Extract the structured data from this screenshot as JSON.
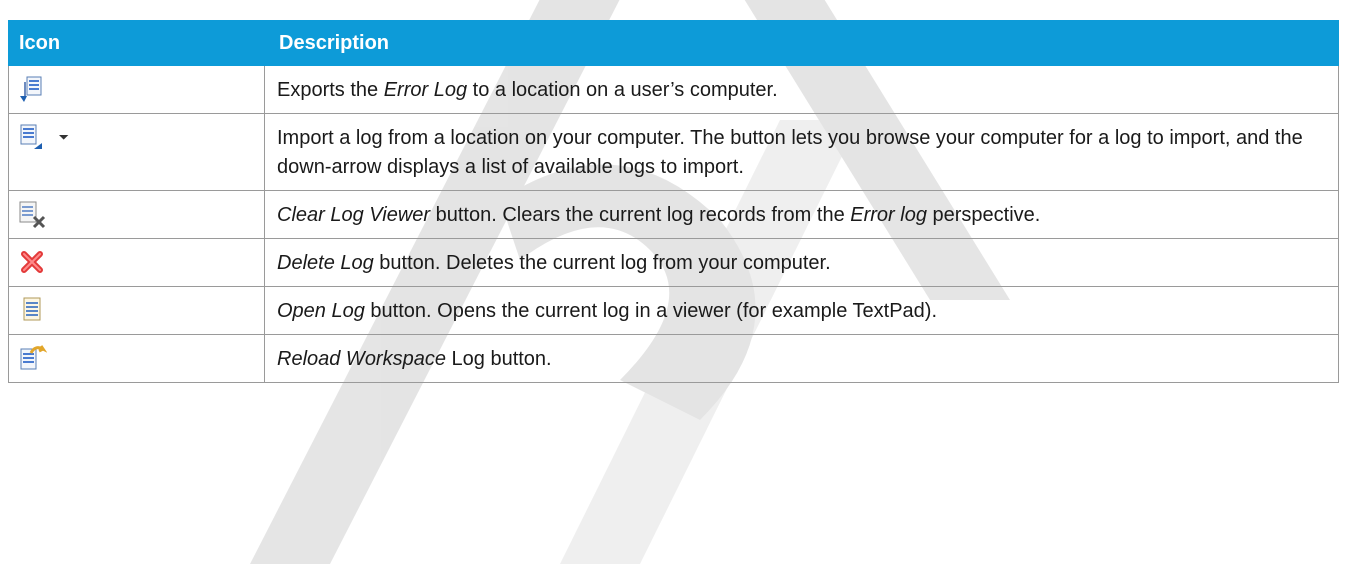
{
  "table": {
    "headers": {
      "icon": "Icon",
      "description": "Description"
    },
    "rows": [
      {
        "icon": "export-log-icon",
        "extra_icon": "",
        "parts": [
          {
            "text": "Exports the ",
            "italic": false
          },
          {
            "text": "Error Log",
            "italic": true
          },
          {
            "text": " to a location on a user’s computer.",
            "italic": false
          }
        ]
      },
      {
        "icon": "import-log-icon",
        "extra_icon": "dropdown-arrow-icon",
        "parts": [
          {
            "text": "Import a log from a location on your computer. The button lets you browse your computer for a log to import, and the down-arrow displays a list of available logs to import.",
            "italic": false
          }
        ]
      },
      {
        "icon": "clear-log-viewer-icon",
        "extra_icon": "",
        "parts": [
          {
            "text": "Clear Log Viewer",
            "italic": true
          },
          {
            "text": " button. Clears the current log records from the ",
            "italic": false
          },
          {
            "text": "Error log",
            "italic": true
          },
          {
            "text": " perspective.",
            "italic": false
          }
        ]
      },
      {
        "icon": "delete-log-icon",
        "extra_icon": "",
        "parts": [
          {
            "text": "Delete Log",
            "italic": true
          },
          {
            "text": " button. Deletes the current log from your computer.",
            "italic": false
          }
        ]
      },
      {
        "icon": "open-log-icon",
        "extra_icon": "",
        "parts": [
          {
            "text": "Open Log",
            "italic": true
          },
          {
            "text": " button. Opens the current log in a viewer (for example TextPad).",
            "italic": false
          }
        ]
      },
      {
        "icon": "reload-workspace-log-icon",
        "extra_icon": "",
        "parts": [
          {
            "text": "Reload Workspace",
            "italic": true
          },
          {
            "text": " Log button.",
            "italic": false
          }
        ]
      }
    ]
  },
  "colors": {
    "header_bg": "#0d9bd8",
    "header_text": "#ffffff",
    "border": "#9a9a9a",
    "watermark": "#d9d9d9"
  }
}
